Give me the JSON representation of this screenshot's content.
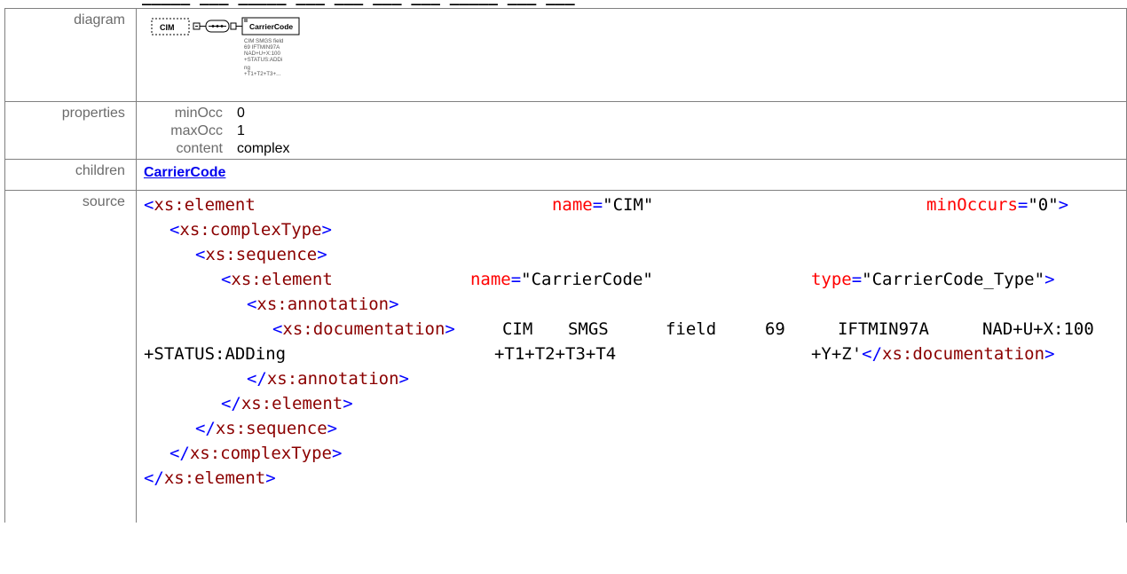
{
  "labels": {
    "diagram": "diagram",
    "properties": "properties",
    "children": "children",
    "source": "source"
  },
  "diagram": {
    "element_name": "CIM",
    "child_name": "CarrierCode",
    "doc_lines": [
      "CIM SMGS field",
      "69 IFTMIN97A",
      "NAD+U+X:100",
      "+STATUS:ADDi",
      "ng",
      "+T1+T2+T3+..."
    ]
  },
  "properties": [
    {
      "key": "minOcc",
      "value": "0"
    },
    {
      "key": "maxOcc",
      "value": "1"
    },
    {
      "key": "content",
      "value": "complex"
    }
  ],
  "children": {
    "link": "CarrierCode"
  },
  "source": {
    "l1_tag": "xs:element",
    "l1_attr1": "name",
    "l1_val1": "\"CIM\"",
    "l1_attr2": "minOccurs",
    "l1_val2": "\"0\"",
    "l2_tag": "xs:complexType",
    "l3_tag": "xs:sequence",
    "l4_tag": "xs:element",
    "l4_attr1": "name",
    "l4_val1": "\"CarrierCode\"",
    "l4_attr2": "type",
    "l4_val2": "\"CarrierCode_Type\"",
    "l5_tag": "xs:annotation",
    "l6_tag": "xs:documentation",
    "doc_words_1": [
      "CIM",
      "SMGS",
      "field",
      "69",
      "IFTMIN97A",
      "NAD+U+X:100"
    ],
    "doc_words_2": [
      "+STATUS:ADDing",
      "+T1+T2+T3+T4",
      "+Y+Z'"
    ],
    "l7_close": "xs:annotation",
    "l8_close": "xs:element",
    "l9_close": "xs:sequence",
    "l10_close": "xs:complexType",
    "l11_close": "xs:element"
  }
}
